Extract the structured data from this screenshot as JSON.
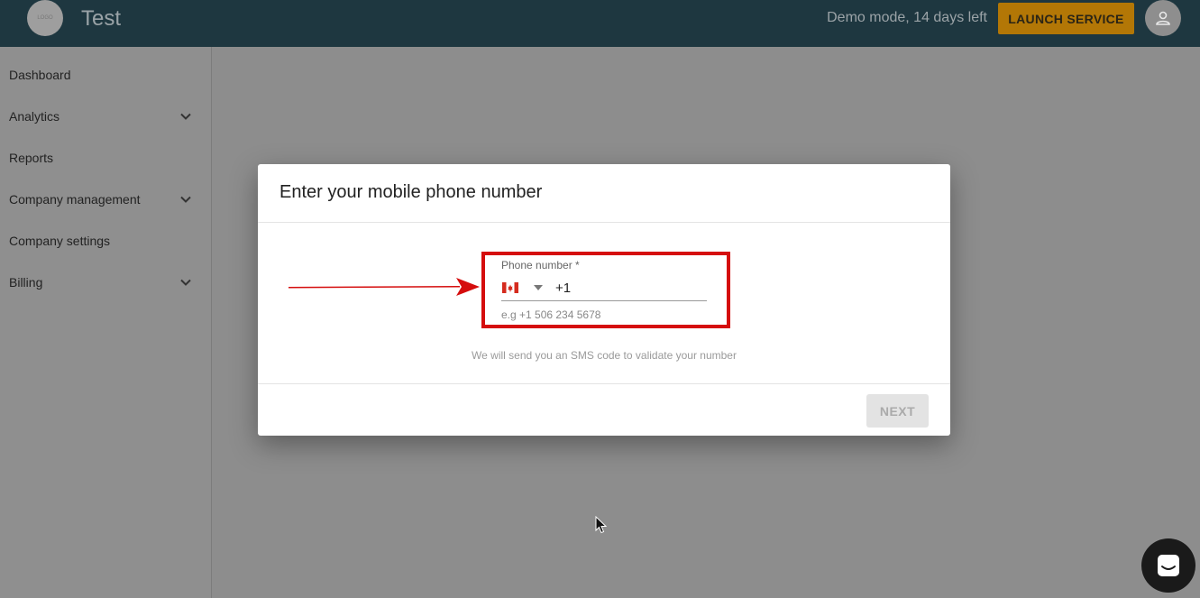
{
  "header": {
    "logo_text": "LOGO",
    "app_title": "Test",
    "demo_text": "Demo mode, 14 days left",
    "launch_label": "LAUNCH SERVICE",
    "avatar_icon": "user-icon"
  },
  "sidebar": {
    "items": [
      {
        "label": "Dashboard",
        "expandable": false
      },
      {
        "label": "Analytics",
        "expandable": true
      },
      {
        "label": "Reports",
        "expandable": false
      },
      {
        "label": "Company management",
        "expandable": true
      },
      {
        "label": "Company settings",
        "expandable": false
      },
      {
        "label": "Billing",
        "expandable": true
      }
    ]
  },
  "modal": {
    "title": "Enter your mobile phone number",
    "phone_label": "Phone number *",
    "country_flag_icon": "canada-flag-icon",
    "phone_value": "+1",
    "phone_hint": "e.g +1 506 234 5678",
    "sms_note": "We will send you an SMS code to validate your number",
    "next_label": "NEXT"
  },
  "colors": {
    "header_bg": "#1e3740",
    "accent": "#b37706",
    "highlight": "#d50d0d",
    "overlay": "#8d8d8d"
  }
}
